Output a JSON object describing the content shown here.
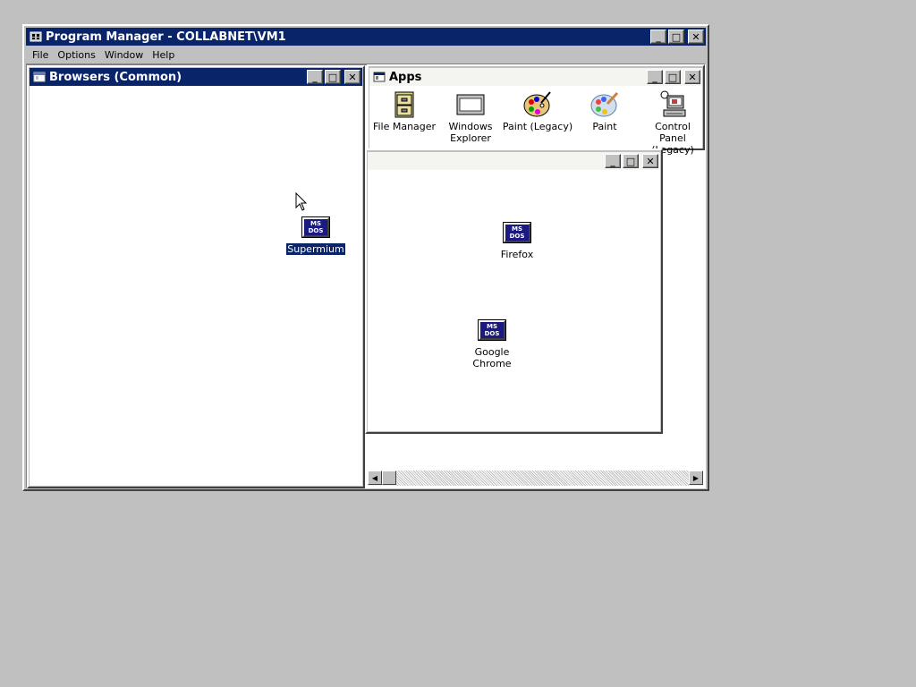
{
  "program_manager": {
    "title": "Program Manager - COLLABNET\\VM1",
    "menu": [
      "File",
      "Options",
      "Window",
      "Help"
    ]
  },
  "browsers_window": {
    "title": "Browsers (Common)",
    "icons": [
      {
        "label": "Supermium",
        "icon": "msdos-icon",
        "selected": true
      }
    ]
  },
  "apps_window": {
    "title": "Apps",
    "icons": [
      {
        "label": "File Manager",
        "icon": "file-cabinet-icon"
      },
      {
        "label": "Windows Explorer",
        "icon": "window-icon"
      },
      {
        "label": "Paint (Legacy)",
        "icon": "palette-icon"
      },
      {
        "label": "Paint",
        "icon": "palette-icon"
      },
      {
        "label": "Control Panel (Legacy)",
        "icon": "computer-icon"
      }
    ]
  },
  "untitled_window": {
    "title": "",
    "icons": [
      {
        "label": "Firefox",
        "icon": "msdos-icon"
      },
      {
        "label": "Google Chrome",
        "icon": "msdos-icon"
      }
    ]
  },
  "window_buttons": {
    "minimize": "_",
    "maximize": "□",
    "close": "✕"
  },
  "msdos_icon_text": {
    "line1": "MS",
    "line2": "DOS"
  }
}
